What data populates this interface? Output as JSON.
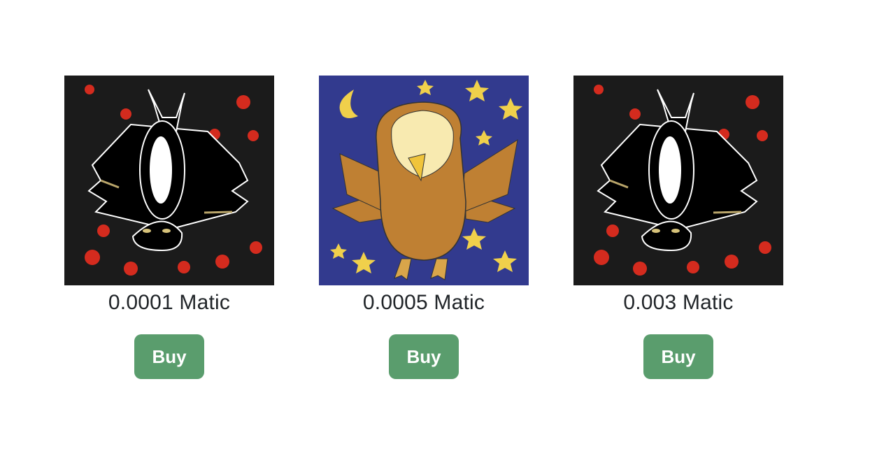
{
  "colors": {
    "button_bg": "#5a9d6d",
    "button_text": "#ffffff",
    "text": "#212529",
    "bat_bg": "#1b1b1b",
    "owl_bg": "#323a8e"
  },
  "nfts": [
    {
      "image": "bat-artwork",
      "price": "0.0001 Matic",
      "buy_label": "Buy"
    },
    {
      "image": "owl-artwork",
      "price": "0.0005 Matic",
      "buy_label": "Buy"
    },
    {
      "image": "bat-artwork",
      "price": "0.003 Matic",
      "buy_label": "Buy"
    }
  ]
}
